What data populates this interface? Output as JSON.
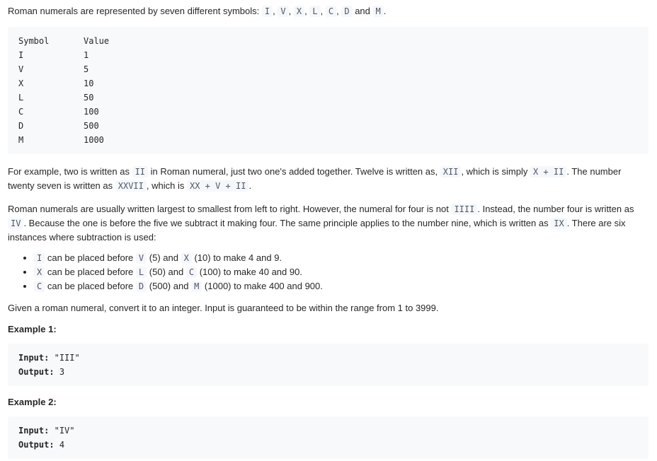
{
  "intro": {
    "text": "Roman numerals are represented by seven different symbols:",
    "sep": ",",
    "and": "and",
    "end": ".",
    "symbols": [
      "I",
      "V",
      "X",
      "L",
      "C",
      "D",
      "M"
    ]
  },
  "table": {
    "header_symbol": "Symbol",
    "header_value": "Value",
    "rows": [
      {
        "symbol": "I",
        "value": "1"
      },
      {
        "symbol": "V",
        "value": "5"
      },
      {
        "symbol": "X",
        "value": "10"
      },
      {
        "symbol": "L",
        "value": "50"
      },
      {
        "symbol": "C",
        "value": "100"
      },
      {
        "symbol": "D",
        "value": "500"
      },
      {
        "symbol": "M",
        "value": "1000"
      }
    ]
  },
  "example_paragraph": {
    "t1": "For example, two is written as",
    "c1": "II",
    "t2": "in Roman numeral, just two one's added together. Twelve is written as,",
    "c2": "XII",
    "t3": ", which is simply",
    "c3": "X + II",
    "t4": ". The number twenty seven is written as",
    "c4": "XXVII",
    "t5": ", which is",
    "c5": "XX + V + II",
    "t6": "."
  },
  "rules_paragraph": {
    "t1": "Roman numerals are usually written largest to smallest from left to right. However, the numeral for four is not",
    "c1": "IIII",
    "t2": ". Instead, the number four is written as",
    "c2": "IV",
    "t3": ". Because the one is before the five we subtract it making four. The same principle applies to the number nine, which is written as",
    "c3": "IX",
    "t4": ". There are six instances where subtraction is used:"
  },
  "bullets": [
    {
      "a": "I",
      "t1": "can be placed before",
      "b": "V",
      "t2": "(5) and",
      "c": "X",
      "t3": "(10) to make 4 and 9."
    },
    {
      "a": "X",
      "t1": "can be placed before",
      "b": "L",
      "t2": "(50) and",
      "c": "C",
      "t3": "(100) to make 40 and 90."
    },
    {
      "a": "C",
      "t1": "can be placed before",
      "b": "D",
      "t2": "(500) and",
      "c": "M",
      "t3": "(1000) to make 400 and 900."
    }
  ],
  "task": "Given a roman numeral, convert it to an integer. Input is guaranteed to be within the range from 1 to 3999.",
  "examples": [
    {
      "title": "Example 1:",
      "input_label": "Input:",
      "input": "\"III\"",
      "output_label": "Output:",
      "output": "3"
    },
    {
      "title": "Example 2:",
      "input_label": "Input:",
      "input": "\"IV\"",
      "output_label": "Output:",
      "output": "4"
    }
  ]
}
